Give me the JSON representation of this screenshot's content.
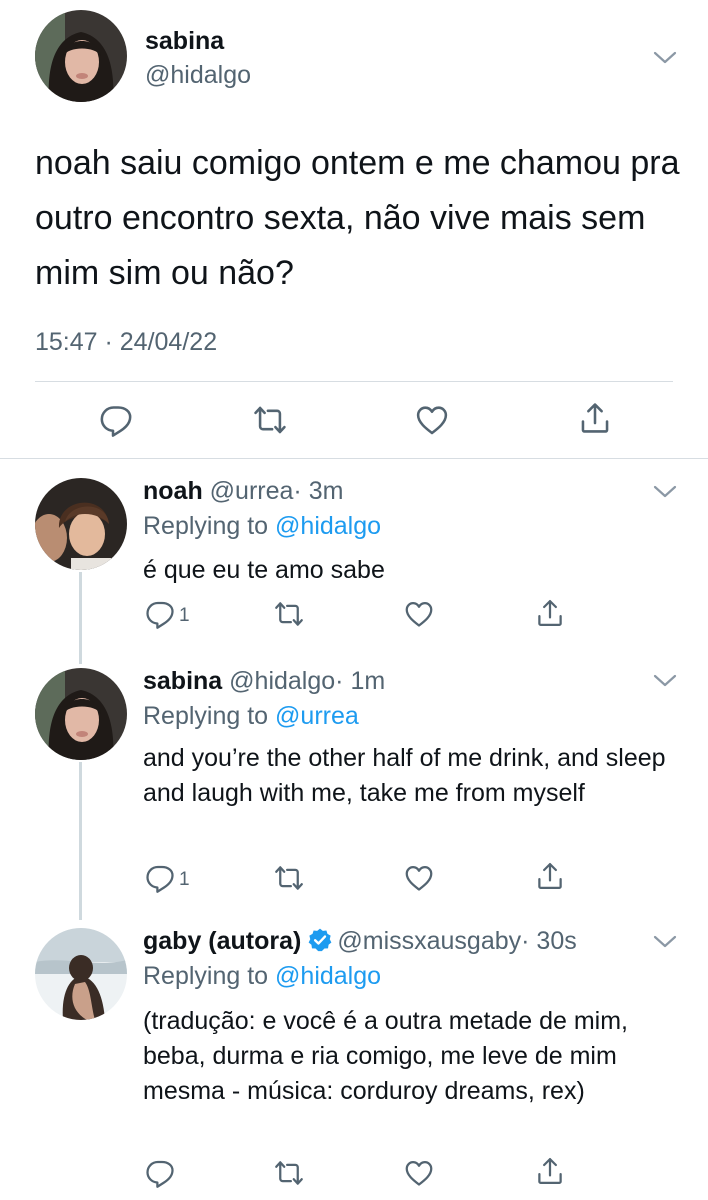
{
  "main_tweet": {
    "name": "sabina",
    "handle": "@hidalgo",
    "text": "noah saiu comigo ontem e me chamou pra outro encontro sexta, não vive mais sem mim sim ou não?",
    "timestamp": "15:47 · 24/04/22",
    "icons": [
      "reply-icon",
      "retweet-icon",
      "like-icon",
      "share-icon"
    ]
  },
  "replies": [
    {
      "name": "noah",
      "handle": "@urrea",
      "age": "· 3m",
      "replying_label": "Replying to",
      "replying_to": "@hidalgo",
      "text": "é que eu te amo sabe",
      "reply_count": "1"
    },
    {
      "name": "sabina",
      "handle": "@hidalgo",
      "age": "· 1m",
      "replying_label": "Replying to",
      "replying_to": "@urrea",
      "text": "and you’re the other half of me drink, and sleep and laugh with me, take me from myself",
      "reply_count": "1"
    },
    {
      "name": "gaby (autora)",
      "handle": "@missxausgaby",
      "age": "· 30s",
      "verified": true,
      "replying_label": "Replying to",
      "replying_to": "@hidalgo",
      "text": "(tradução: e você é a outra metade de mim, beba, durma e ria comigo, me leve de mim mesma - música: corduroy dreams, rex)",
      "reply_count": ""
    }
  ],
  "colors": {
    "text": "#0f1419",
    "secondary": "#536471",
    "link": "#1d9bf0",
    "divider": "#d7dde2",
    "thread_line": "#cfd9de"
  }
}
